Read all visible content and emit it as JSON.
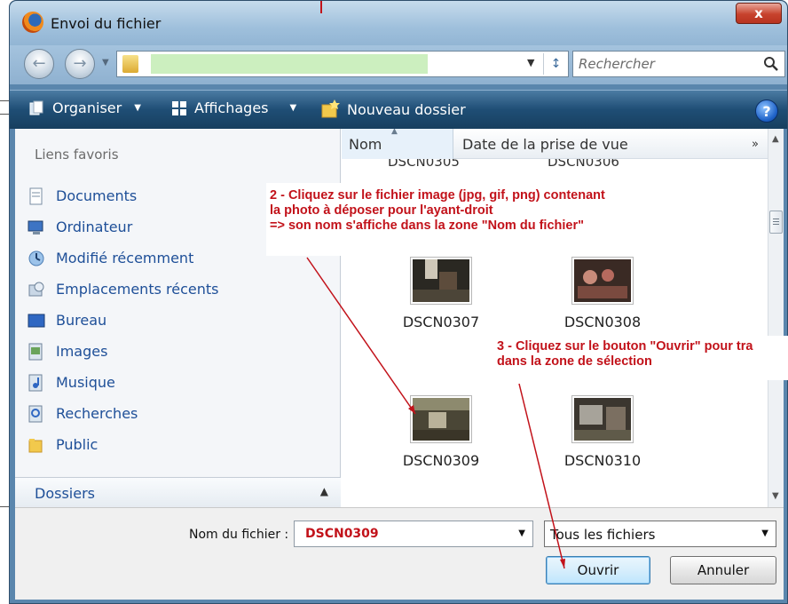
{
  "window": {
    "title": "Envoi du fichier",
    "close_label": "x"
  },
  "address": {
    "search_placeholder": "Rechercher"
  },
  "toolbar": {
    "organize_label": "Organiser",
    "views_label": "Affichages",
    "new_folder_label": "Nouveau dossier",
    "help_label": "?"
  },
  "nav": {
    "favorites_heading": "Liens favoris",
    "favorites": [
      {
        "label": "Documents",
        "icon": "documents-icon"
      },
      {
        "label": "Ordinateur",
        "icon": "computer-icon"
      },
      {
        "label": "Modifié récemment",
        "icon": "recent-changes-icon"
      },
      {
        "label": "Emplacements récents",
        "icon": "recent-places-icon"
      },
      {
        "label": "Bureau",
        "icon": "desktop-icon"
      },
      {
        "label": "Images",
        "icon": "pictures-icon"
      },
      {
        "label": "Musique",
        "icon": "music-icon"
      },
      {
        "label": "Recherches",
        "icon": "searches-icon"
      },
      {
        "label": "Public",
        "icon": "public-folder-icon"
      }
    ],
    "folders_label": "Dossiers"
  },
  "files": {
    "columns": [
      "Nom",
      "Date de la prise de vue"
    ],
    "more_columns": "»",
    "clipped_row": [
      "DSCN0305",
      "DSCN0306"
    ],
    "items": [
      {
        "name": "DSCN0307"
      },
      {
        "name": "DSCN0308"
      },
      {
        "name": "DSCN0309"
      },
      {
        "name": "DSCN0310"
      }
    ]
  },
  "footer": {
    "filename_label": "Nom du fichier :",
    "filename_value": "DSCN0309",
    "filetype_value": "Tous les fichiers",
    "open_label": "Ouvrir",
    "cancel_label": "Annuler"
  },
  "annotations": {
    "step2_lines": [
      "2 - Cliquez sur le fichier image (jpg, gif, png) contenant",
      "la photo à déposer pour l'ayant-droit",
      "=> son nom s'affiche dans la zone \"Nom du fichier\""
    ],
    "step3_lines": [
      "3 - Cliquez sur le bouton \"Ouvrir\" pour tra",
      "dans la zone de sélection"
    ]
  },
  "colors": {
    "annotation_red": "#c2121a",
    "link_blue": "#1e4f98",
    "toolbar_dark": "#1f4e75"
  }
}
